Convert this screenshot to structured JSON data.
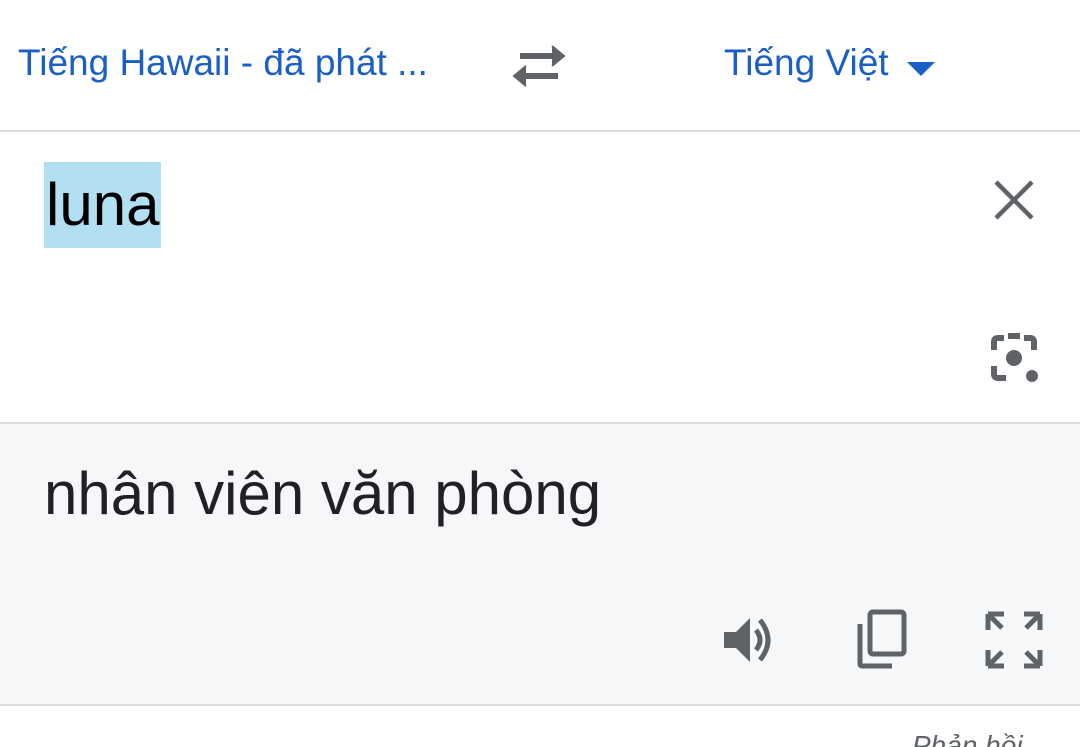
{
  "header": {
    "source_language": "Tiếng Hawaii - đã phát ...",
    "target_language": "Tiếng Việt",
    "swap_icon": "swap-arrows-icon",
    "dropdown_icon": "caret-down-icon"
  },
  "source": {
    "text": "luna",
    "clear_icon": "close-icon",
    "camera_icon": "camera-lens-icon"
  },
  "output": {
    "text": "nhân viên văn phòng",
    "speaker_icon": "speaker-icon",
    "copy_icon": "copy-icon",
    "fullscreen_icon": "fullscreen-icon"
  },
  "footer": {
    "feedback_label": "Phản hồi"
  },
  "colors": {
    "accent": "#1a5fc7",
    "selection": "#b3dff3",
    "icon": "#5f6368",
    "output_bg": "#f6f7f9",
    "divider": "#dadce0"
  }
}
